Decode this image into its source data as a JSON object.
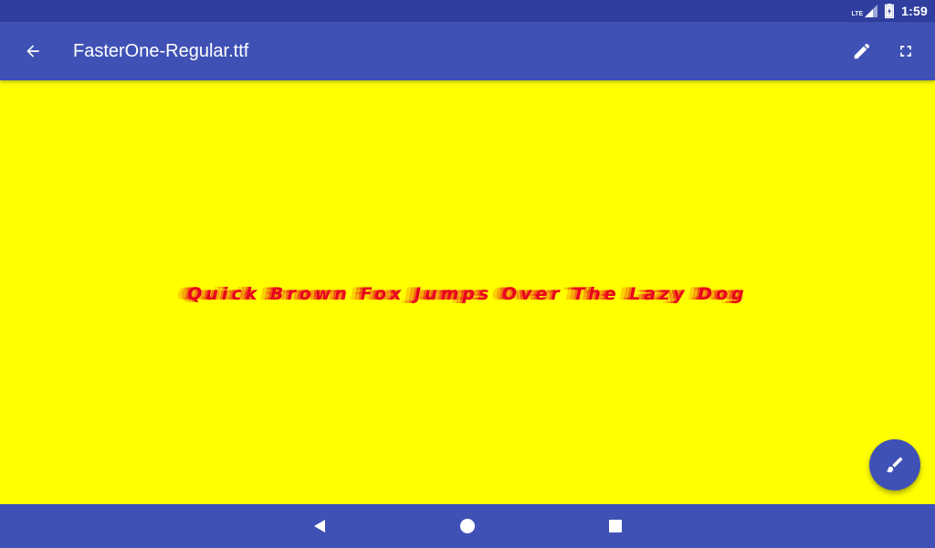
{
  "status_bar": {
    "network_label": "LTE",
    "clock": "1:59",
    "icons": [
      "signal-icon",
      "battery-charging-icon"
    ]
  },
  "app_bar": {
    "title": "FasterOne-Regular.ttf",
    "back_icon": "arrow-back-icon",
    "actions": [
      {
        "name": "edit-button",
        "icon": "pencil-icon"
      },
      {
        "name": "fullscreen-button",
        "icon": "fullscreen-icon"
      }
    ]
  },
  "preview": {
    "sample_text": "Quick Brown Fox Jumps Over The Lazy Dog",
    "background_color": "#ffff00",
    "text_color": "#e8001e"
  },
  "fab": {
    "icon": "brush-icon"
  },
  "nav_bar": {
    "buttons": [
      "back-nav-icon",
      "home-nav-icon",
      "recents-nav-icon"
    ]
  },
  "colors": {
    "primary": "#3f51b5",
    "primary_dark": "#303f9f"
  }
}
